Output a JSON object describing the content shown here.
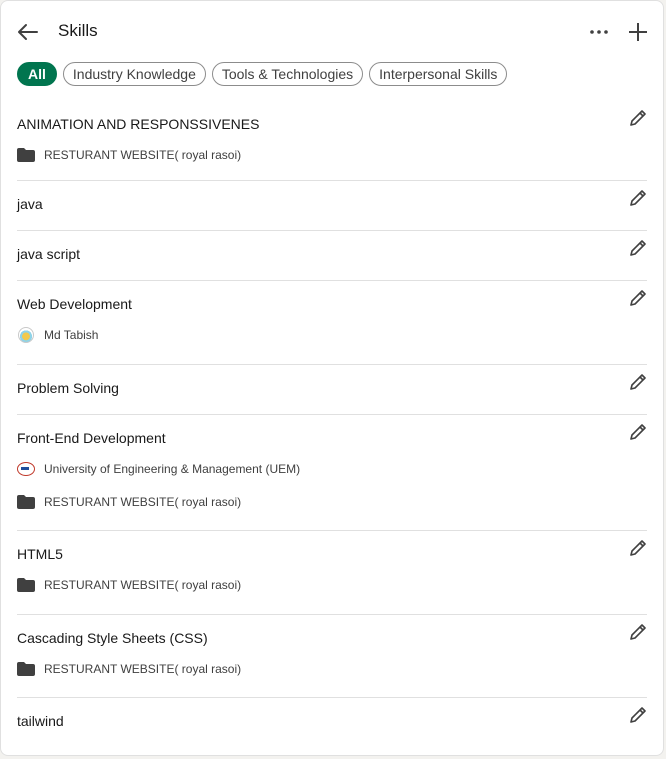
{
  "header": {
    "title": "Skills"
  },
  "filters": [
    {
      "label": "All",
      "active": true
    },
    {
      "label": "Industry Knowledge"
    },
    {
      "label": "Tools & Technologies"
    },
    {
      "label": "Interpersonal Skills"
    }
  ],
  "skills": [
    {
      "name": "ANIMATION AND RESPONSSIVENES",
      "subs": [
        {
          "icon": "folder-icon",
          "text": "RESTURANT WEBSITE( royal rasoi)"
        }
      ]
    },
    {
      "name": "java",
      "subs": []
    },
    {
      "name": "java script",
      "subs": []
    },
    {
      "name": "Web Development",
      "subs": [
        {
          "icon": "profile-logo-icon",
          "text": "Md Tabish"
        }
      ]
    },
    {
      "name": "Problem Solving",
      "subs": []
    },
    {
      "name": "Front-End Development",
      "subs": [
        {
          "icon": "uem-logo-icon",
          "text": "University of Engineering & Management (UEM)"
        },
        {
          "icon": "folder-icon",
          "text": "RESTURANT WEBSITE( royal rasoi)"
        }
      ]
    },
    {
      "name": "HTML5",
      "subs": [
        {
          "icon": "folder-icon",
          "text": "RESTURANT WEBSITE( royal rasoi)"
        }
      ]
    },
    {
      "name": "Cascading Style Sheets (CSS)",
      "subs": [
        {
          "icon": "folder-icon",
          "text": "RESTURANT WEBSITE( royal rasoi)"
        }
      ]
    },
    {
      "name": "tailwind",
      "subs": []
    }
  ],
  "colors": {
    "accent": "#01754f",
    "divider": "#e0e0e0",
    "text": "#191919"
  }
}
